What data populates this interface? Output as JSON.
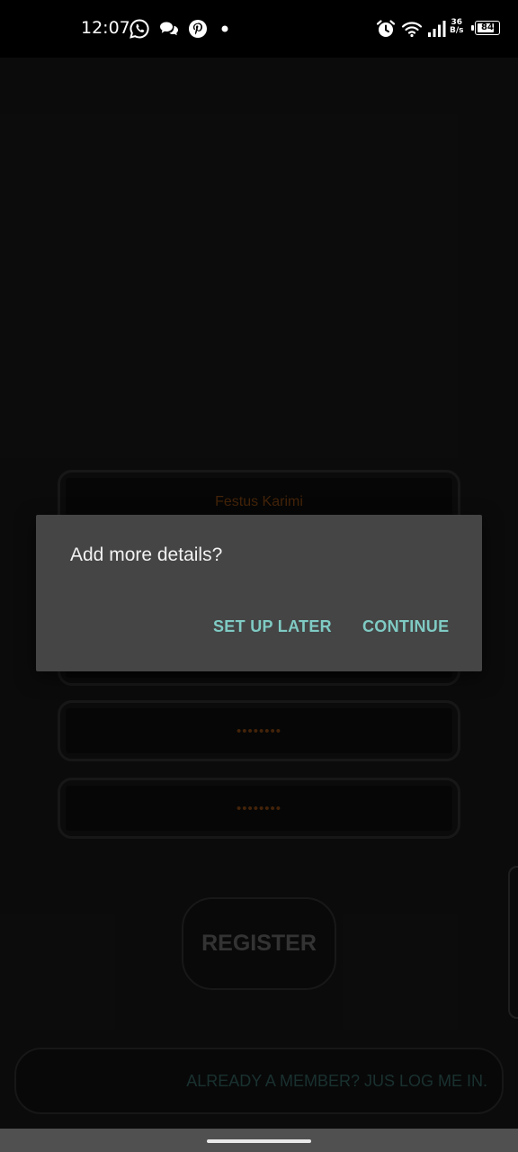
{
  "status_bar": {
    "time": "12:07",
    "notification_icons": [
      "whatsapp-icon",
      "chat-bubble-icon",
      "pinterest-icon",
      "dot-icon"
    ],
    "system_icons": [
      "alarm-icon",
      "wifi-icon",
      "signal-icon"
    ],
    "net_speed_value": "36",
    "net_speed_unit": "B/s",
    "battery_level": "84",
    "battery_fraction": 0.84
  },
  "form": {
    "name_value": "Festus Karimi",
    "password_value": "••••••••",
    "confirm_password_value": "••••••••",
    "register_label": "REGISTER",
    "login_link_label": "ALREADY A MEMBER? JUS LOG ME IN."
  },
  "dialog": {
    "title": "Add more details?",
    "setup_later_label": "SET UP LATER",
    "continue_label": "CONTINUE"
  },
  "colors": {
    "background": "#151515",
    "field_text": "#7a4012",
    "dialog_bg": "#454545",
    "dialog_button": "#7fcbc4",
    "login_link": "#2f5956"
  }
}
